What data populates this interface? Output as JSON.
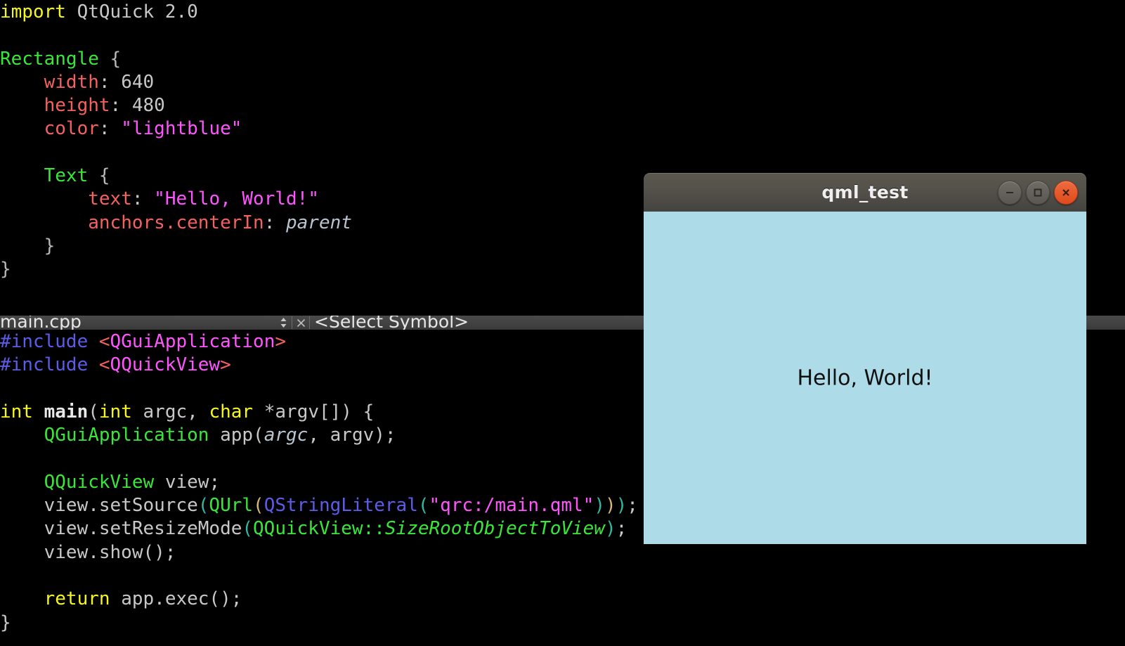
{
  "desktop": {
    "background_color": "#000000"
  },
  "editor": {
    "qml_pane": {
      "file_language": "QML",
      "lines": [
        {
          "tokens": [
            {
              "t": "import ",
              "c": "kw"
            },
            {
              "t": "QtQuick 2.0",
              "c": "plain"
            }
          ]
        },
        {
          "tokens": []
        },
        {
          "tokens": [
            {
              "t": "Rectangle",
              "c": "type"
            },
            {
              "t": " {",
              "c": "brace"
            }
          ]
        },
        {
          "tokens": [
            {
              "t": "    ",
              "c": "plain"
            },
            {
              "t": "width",
              "c": "prop"
            },
            {
              "t": ": ",
              "c": "plain"
            },
            {
              "t": "640",
              "c": "num"
            }
          ]
        },
        {
          "tokens": [
            {
              "t": "    ",
              "c": "plain"
            },
            {
              "t": "height",
              "c": "prop"
            },
            {
              "t": ": ",
              "c": "plain"
            },
            {
              "t": "480",
              "c": "num"
            }
          ]
        },
        {
          "tokens": [
            {
              "t": "    ",
              "c": "plain"
            },
            {
              "t": "color",
              "c": "prop"
            },
            {
              "t": ": ",
              "c": "plain"
            },
            {
              "t": "\"lightblue\"",
              "c": "str"
            }
          ]
        },
        {
          "tokens": []
        },
        {
          "tokens": [
            {
              "t": "    ",
              "c": "plain"
            },
            {
              "t": "Text",
              "c": "type"
            },
            {
              "t": " {",
              "c": "brace"
            }
          ]
        },
        {
          "tokens": [
            {
              "t": "        ",
              "c": "plain"
            },
            {
              "t": "text",
              "c": "prop"
            },
            {
              "t": ": ",
              "c": "plain"
            },
            {
              "t": "\"Hello, World!\"",
              "c": "str"
            }
          ]
        },
        {
          "tokens": [
            {
              "t": "        ",
              "c": "plain"
            },
            {
              "t": "anchors.centerIn",
              "c": "prop"
            },
            {
              "t": ": ",
              "c": "plain"
            },
            {
              "t": "parent",
              "c": "italic"
            }
          ]
        },
        {
          "tokens": [
            {
              "t": "    }",
              "c": "brace"
            }
          ]
        },
        {
          "tokens": [
            {
              "t": "}",
              "c": "brace"
            }
          ]
        }
      ]
    },
    "cpp_pane": {
      "file_language": "C++",
      "lines": [
        {
          "tokens": [
            {
              "t": "#include",
              "c": "pre"
            },
            {
              "t": " ",
              "c": "plain"
            },
            {
              "t": "<",
              "c": "angle"
            },
            {
              "t": "QGuiApplication",
              "c": "header"
            },
            {
              "t": ">",
              "c": "angle"
            }
          ]
        },
        {
          "tokens": [
            {
              "t": "#include",
              "c": "pre"
            },
            {
              "t": " ",
              "c": "plain"
            },
            {
              "t": "<",
              "c": "angle"
            },
            {
              "t": "QQuickView",
              "c": "header"
            },
            {
              "t": ">",
              "c": "angle"
            }
          ]
        },
        {
          "tokens": []
        },
        {
          "tokens": [
            {
              "t": "int ",
              "c": "kw"
            },
            {
              "t": "main",
              "c": "fn"
            },
            {
              "t": "(",
              "c": "plain"
            },
            {
              "t": "int",
              "c": "kw"
            },
            {
              "t": " argc, ",
              "c": "plain"
            },
            {
              "t": "char",
              "c": "kw"
            },
            {
              "t": " *argv[]) {",
              "c": "plain"
            }
          ]
        },
        {
          "tokens": [
            {
              "t": "    ",
              "c": "plain"
            },
            {
              "t": "QGuiApplication",
              "c": "type"
            },
            {
              "t": " app(",
              "c": "plain"
            },
            {
              "t": "argc",
              "c": "arg"
            },
            {
              "t": ", argv);",
              "c": "plain"
            }
          ]
        },
        {
          "tokens": []
        },
        {
          "tokens": [
            {
              "t": "    ",
              "c": "plain"
            },
            {
              "t": "QQuickView",
              "c": "type"
            },
            {
              "t": " view;",
              "c": "plain"
            }
          ]
        },
        {
          "tokens": [
            {
              "t": "    view.setSource",
              "c": "plain"
            },
            {
              "t": "(",
              "c": "paren2"
            },
            {
              "t": "QUrl",
              "c": "type"
            },
            {
              "t": "(",
              "c": "paren"
            },
            {
              "t": "QStringLiteral",
              "c": "pre"
            },
            {
              "t": "(",
              "c": "paren2"
            },
            {
              "t": "\"qrc:/main.qml\"",
              "c": "str"
            },
            {
              "t": ")",
              "c": "paren2"
            },
            {
              "t": ")",
              "c": "paren"
            },
            {
              "t": ")",
              "c": "paren2"
            },
            {
              "t": ";",
              "c": "plain"
            }
          ]
        },
        {
          "tokens": [
            {
              "t": "    view.setResizeMode",
              "c": "plain"
            },
            {
              "t": "(",
              "c": "paren2"
            },
            {
              "t": "QQuickView",
              "c": "type"
            },
            {
              "t": "::",
              "c": "type"
            },
            {
              "t": "SizeRootObjectToView",
              "c": "enum"
            },
            {
              "t": ")",
              "c": "paren2"
            },
            {
              "t": ";",
              "c": "plain"
            }
          ]
        },
        {
          "tokens": [
            {
              "t": "    view.show();",
              "c": "plain"
            }
          ]
        },
        {
          "tokens": []
        },
        {
          "tokens": [
            {
              "t": "    ",
              "c": "plain"
            },
            {
              "t": "return",
              "c": "kw"
            },
            {
              "t": " app.exec();",
              "c": "plain"
            }
          ]
        },
        {
          "tokens": [
            {
              "t": "}",
              "c": "plain"
            }
          ]
        }
      ]
    },
    "toolbar": {
      "file_label": "main.cpp",
      "symbol_label": "<Select Symbol>",
      "sort_icon": "updown-arrows-icon",
      "close_icon": "close-icon",
      "background_color": "#424242"
    }
  },
  "qml_window": {
    "title": "qml_test",
    "content_text": "Hello, World!",
    "content_background": "#addbe8",
    "titlebar_background": "#55524b",
    "controls": [
      {
        "name": "minimize-button",
        "icon": "minus-icon",
        "color": "#5a5752"
      },
      {
        "name": "maximize-button",
        "icon": "square-icon",
        "color": "#5a5752"
      },
      {
        "name": "close-button",
        "icon": "x-icon",
        "color": "#df4a1c"
      }
    ]
  }
}
